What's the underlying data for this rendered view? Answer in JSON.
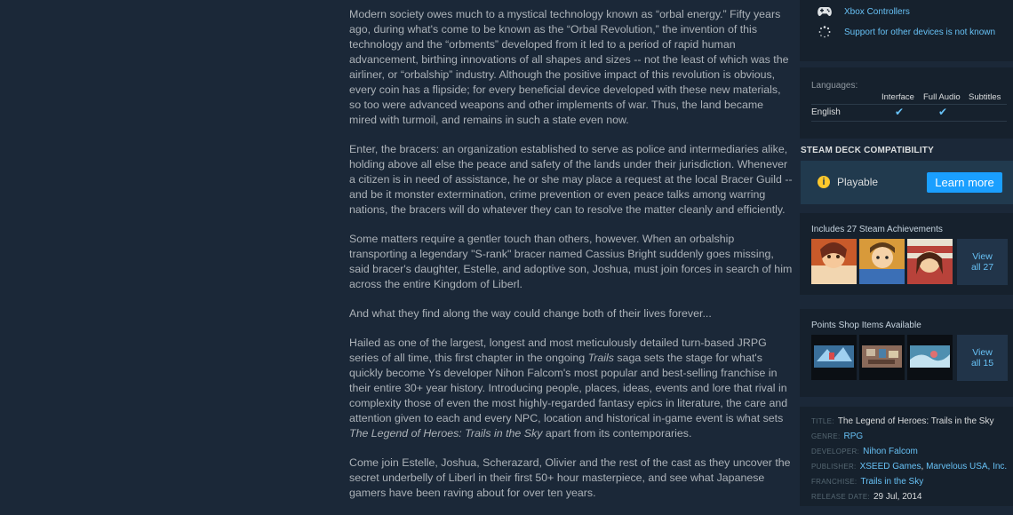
{
  "description": {
    "p1": "Modern society owes much to a mystical technology known as “orbal energy.” Fifty years ago, during what's come to be known as the “Orbal Revolution,” the invention of this technology and the “orbments” developed from it led to a period of rapid human advancement, birthing innovations of all shapes and sizes -- not the least of which was the airliner, or “orbalship” industry. Although the positive impact of this revolution is obvious, every coin has a flipside; for every beneficial device developed with these new materials, so too were advanced weapons and other implements of war. Thus, the land became mired with turmoil, and remains in such a state even now.",
    "p2": "Enter, the bracers: an organization established to serve as police and intermediaries alike, holding above all else the peace and safety of the lands under their jurisdiction. Whenever a citizen is in need of assistance, he or she may place a request at the local Bracer Guild -- and be it monster extermination, crime prevention or even peace talks among warring nations, the bracers will do whatever they can to resolve the matter cleanly and efficiently.",
    "p3": "Some matters require a gentler touch than others, however. When an orbalship transporting a legendary \"S-rank\" bracer named Cassius Bright suddenly goes missing, said bracer's daughter, Estelle, and adoptive son, Joshua, must join forces in search of him across the entire Kingdom of Liberl.",
    "p4": "And what they find along the way could change both of their lives forever...",
    "p5_a": "Hailed as one of the largest, longest and most meticulously detailed turn-based JRPG series of all time, this first chapter in the ongoing ",
    "p5_i1": "Trails",
    "p5_b": " saga sets the stage for what's quickly become Ys developer Nihon Falcom's most popular and best-selling franchise in their entire 30+ year history. Introducing people, places, ideas, events and lore that rival in complexity those of even the most highly-regarded fantasy epics in literature, the care and attention given to each and every NPC, location and historical in-game event is what sets ",
    "p5_i2": "The Legend of Heroes: Trails in the Sky",
    "p5_c": " apart from its contemporaries.",
    "p6": "Come join Estelle, Joshua, Scherazard, Olivier and the rest of the cast as they uncover the secret underbelly of Liberl in their first 50+ hour masterpiece, and see what Japanese gamers have been raving about for over ten years."
  },
  "controllers": {
    "xbox_label": "Xbox Controllers",
    "xbox_icon": "gamepad-icon",
    "other_label": "Support for other devices is not known",
    "other_icon": "loading-icon"
  },
  "languages": {
    "label": "Languages:",
    "headers": [
      "Interface",
      "Full Audio",
      "Subtitles"
    ],
    "rows": [
      {
        "name": "English",
        "interface": "✔",
        "audio": "✔",
        "subtitles": ""
      }
    ]
  },
  "steam_deck": {
    "title": "STEAM DECK COMPATIBILITY",
    "status": "Playable",
    "status_icon": "info-icon",
    "learn_more": "Learn more",
    "accent": "#1a9fff"
  },
  "achievements": {
    "title": "Includes 27 Steam Achievements",
    "view_line1": "View",
    "view_line2": "all 27"
  },
  "points_shop": {
    "title": "Points Shop Items Available",
    "view_line1": "View",
    "view_line2": "all 15"
  },
  "details": {
    "title_key": "TITLE:",
    "title": "The Legend of Heroes: Trails in the Sky",
    "genre_key": "GENRE:",
    "genre": "RPG",
    "developer_key": "DEVELOPER:",
    "developer": "Nihon Falcom",
    "publisher_key": "PUBLISHER:",
    "publisher_1": "XSEED Games",
    "publisher_sep": ", ",
    "publisher_2": "Marvelous USA, Inc.",
    "franchise_key": "FRANCHISE:",
    "franchise": "Trails in the Sky",
    "release_key": "RELEASE DATE:",
    "release_date": "29 Jul, 2014"
  }
}
